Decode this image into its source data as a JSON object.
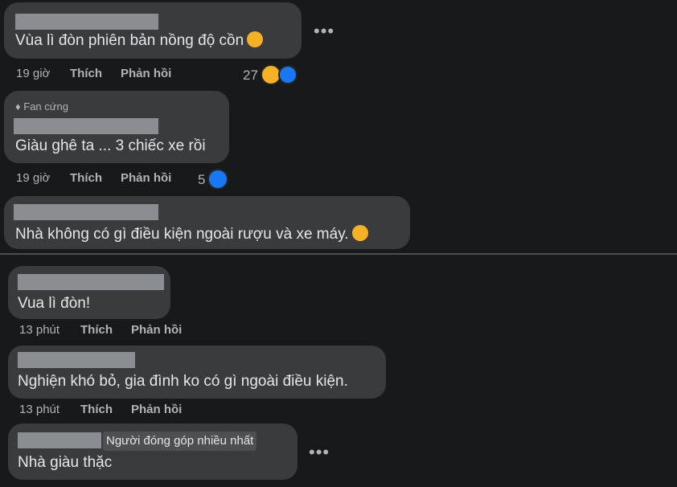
{
  "comments": [
    {
      "text": "Vùa lì đòn phiên bản nồng độ cồn",
      "time": "19 giờ",
      "like": "Thích",
      "reply": "Phản hồi",
      "reaction_count": "27"
    },
    {
      "badge": "Fan cứng",
      "text": "Giàu ghê ta ... 3 chiếc xe rồi",
      "time": "19 giờ",
      "like": "Thích",
      "reply": "Phản hồi",
      "reaction_count": "5"
    },
    {
      "text": "Nhà không có gì điều kiện ngoài rượu và xe máy."
    },
    {
      "text": "Vua lì đòn!",
      "time": "13 phút",
      "like": "Thích",
      "reply": "Phản hồi"
    },
    {
      "text": "Nghiện khó bỏ, gia đình ko có gì ngoài điều kiện.",
      "time": "13 phút",
      "like": "Thích",
      "reply": "Phản hồi"
    },
    {
      "badge": "Người đóng góp nhiều nhất",
      "text": "Nhà giàu thặc"
    }
  ],
  "colors": {
    "background": "#18191a",
    "bubble": "#3a3b3c",
    "like_blue": "#1877f2",
    "haha_yellow": "#f7b125"
  }
}
